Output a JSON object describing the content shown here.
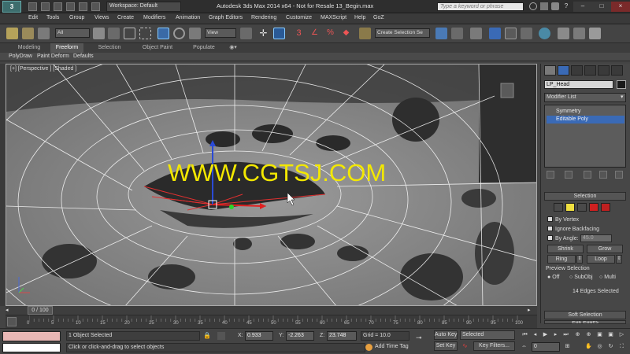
{
  "titlebar": {
    "logo": "3",
    "workspace": "Workspace: Default",
    "title": "Autodesk 3ds Max  2014 x64  - Not for Resale  13_Begin.max",
    "search_placeholder": "Type a keyword or phrase",
    "window_controls": [
      "–",
      "□",
      "×"
    ]
  },
  "menu": [
    "Edit",
    "Tools",
    "Group",
    "Views",
    "Create",
    "Modifiers",
    "Animation",
    "Graph Editors",
    "Rendering",
    "Customize",
    "MAXScript",
    "Help",
    "GoZ"
  ],
  "toolbar": {
    "filter": "All",
    "ref_coord": "View",
    "named_selection": "Create Selection Se"
  },
  "ribbon": {
    "tabs": [
      "Modeling",
      "Freeform",
      "Selection",
      "Object Paint",
      "Populate"
    ],
    "active_tab": "Freeform",
    "sub_items": [
      "PolyDraw",
      "Paint Deform",
      "Defaults"
    ]
  },
  "viewport": {
    "label": "[+] [Perspective ] [Shaded ]",
    "watermark": "WWW.CGTSJ.COM"
  },
  "command_panel": {
    "object_name": "LP_Head",
    "object_color": "#1a1a1a",
    "modifier_list": "Modifier List",
    "stack": [
      "Symmetry",
      "Editable Poly"
    ],
    "selected_stack_item": "Editable Poly",
    "selection_rollout": "Selection",
    "by_vertex": "By Vertex",
    "ignore_backfacing": "Ignore Backfacing",
    "by_angle": "By Angle:",
    "angle_value": "45.0",
    "shrink": "Shrink",
    "grow": "Grow",
    "ring": "Ring",
    "loop": "Loop",
    "preview_selection": "Preview Selection",
    "preview_options": [
      "Off",
      "SubObj",
      "Multi"
    ],
    "edges_selected": "14 Edges Selected",
    "soft_selection": "Soft Selection",
    "edit_edges": "Edit Edges"
  },
  "timeline": {
    "frame_display": "0 / 100",
    "ticks": [
      "0",
      "5",
      "10",
      "15",
      "20",
      "25",
      "30",
      "35",
      "40",
      "45",
      "50",
      "55",
      "60",
      "65",
      "70",
      "75",
      "80",
      "85",
      "90",
      "95",
      "100"
    ]
  },
  "status": {
    "objects_selected": "1 Object Selected",
    "prompt": "Click or click-and-drag to select objects",
    "x_label": "X:",
    "x_value": "0.933",
    "y_label": "Y:",
    "y_value": "-2.263",
    "z_label": "Z:",
    "z_value": "23.748",
    "grid": "Grid = 10.0",
    "add_time_tag": "Add Time Tag",
    "auto_key": "Auto Key",
    "set_key": "Set Key",
    "key_mode": "Selected",
    "key_filters": "Key Filters...",
    "current_frame": "0"
  }
}
